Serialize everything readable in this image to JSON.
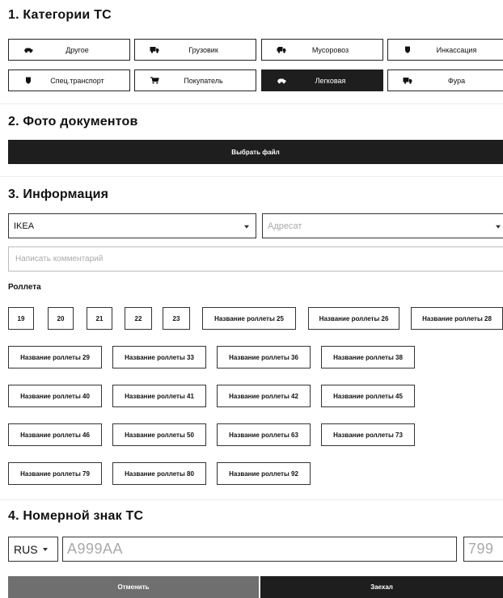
{
  "sections": {
    "categories_title": "1. Категории ТС",
    "docs_title": "2. Фото документов",
    "info_title": "3. Информация",
    "plate_title": "4. Номерной знак ТС"
  },
  "categories": [
    {
      "label": "Другое",
      "icon": "car-icon",
      "active": false
    },
    {
      "label": "Грузовик",
      "icon": "truck-icon",
      "active": false
    },
    {
      "label": "Мусоровоз",
      "icon": "garbage-truck-icon",
      "active": false
    },
    {
      "label": "Инкассация",
      "icon": "shield-icon",
      "active": false
    },
    {
      "label": "Спец.транспорт",
      "icon": "shield-icon",
      "active": false
    },
    {
      "label": "Покупатель",
      "icon": "cart-icon",
      "active": false
    },
    {
      "label": "Легковая",
      "icon": "car-icon",
      "active": true
    },
    {
      "label": "Фура",
      "icon": "truck-icon",
      "active": false
    }
  ],
  "docs": {
    "choose_file_label": "Выбрать файл"
  },
  "info": {
    "company_value": "IKEA",
    "recipient_placeholder": "Адресат",
    "comment_placeholder": "Написать комментарий",
    "rollets_label": "Роллета",
    "rollets": [
      "19",
      "20",
      "21",
      "22",
      "23",
      "Название роллеты 25",
      "Название роллеты 26",
      "Название роллеты 28",
      "Название роллеты 29",
      "Название роллеты 33",
      "Название роллеты 36",
      "Название роллеты 38",
      "Название роллеты 40",
      "Название роллеты 41",
      "Название роллеты 42",
      "Название роллеты 45",
      "Название роллеты 46",
      "Название роллеты 50",
      "Название роллеты 63",
      "Название роллеты 73",
      "Название роллеты 79",
      "Название роллеты 80",
      "Название роллеты 92"
    ]
  },
  "plate": {
    "country": "RUS",
    "number_placeholder": "A999AA",
    "region_placeholder": "799"
  },
  "actions": {
    "cancel_label": "Отменить",
    "arrived_label": "Заехал"
  },
  "colors": {
    "dark": "#1e1e1e",
    "cancel": "#6f6f6f",
    "border": "#222222"
  }
}
